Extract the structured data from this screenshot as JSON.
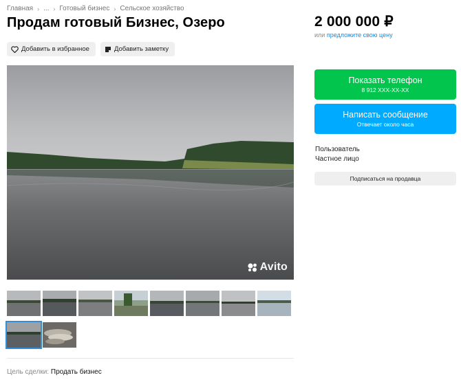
{
  "breadcrumb": {
    "items": [
      "Главная",
      "...",
      "Готовый бизнес",
      "Сельское хозяйство"
    ],
    "separator": "›"
  },
  "listing": {
    "title": "Продам готовый Бизнес, Озеро",
    "add_favorite_label": "Добавить в избранное",
    "add_note_label": "Добавить заметку"
  },
  "price": {
    "amount": "2 000 000 ₽",
    "or_text": "или",
    "offer_link": "предложите свою цену"
  },
  "gallery": {
    "watermark": "Avito",
    "thumbnails": [
      "lake-thumb-1",
      "lake-thumb-2",
      "lake-thumb-3",
      "lake-thumb-4",
      "lake-thumb-5",
      "lake-thumb-6",
      "lake-thumb-7",
      "lake-thumb-8",
      "lake-thumb-9",
      "fish-thumb-10"
    ],
    "active_index": 8
  },
  "contact": {
    "show_phone_label": "Показать телефон",
    "phone_masked": "8 912 XXX-XX-XX",
    "message_label": "Написать сообщение",
    "reply_time": "Отвечает около часа"
  },
  "seller": {
    "role": "Пользователь",
    "type": "Частное лицо",
    "subscribe_label": "Подписаться на продавца"
  },
  "details": {
    "deal_label": "Цель сделки:",
    "deal_value": "Продать бизнес"
  },
  "colors": {
    "green_button": "#01c54c",
    "blue_button": "#00aaff",
    "link": "#0a8ee8",
    "active_thumb_border": "#2f8fd8"
  }
}
